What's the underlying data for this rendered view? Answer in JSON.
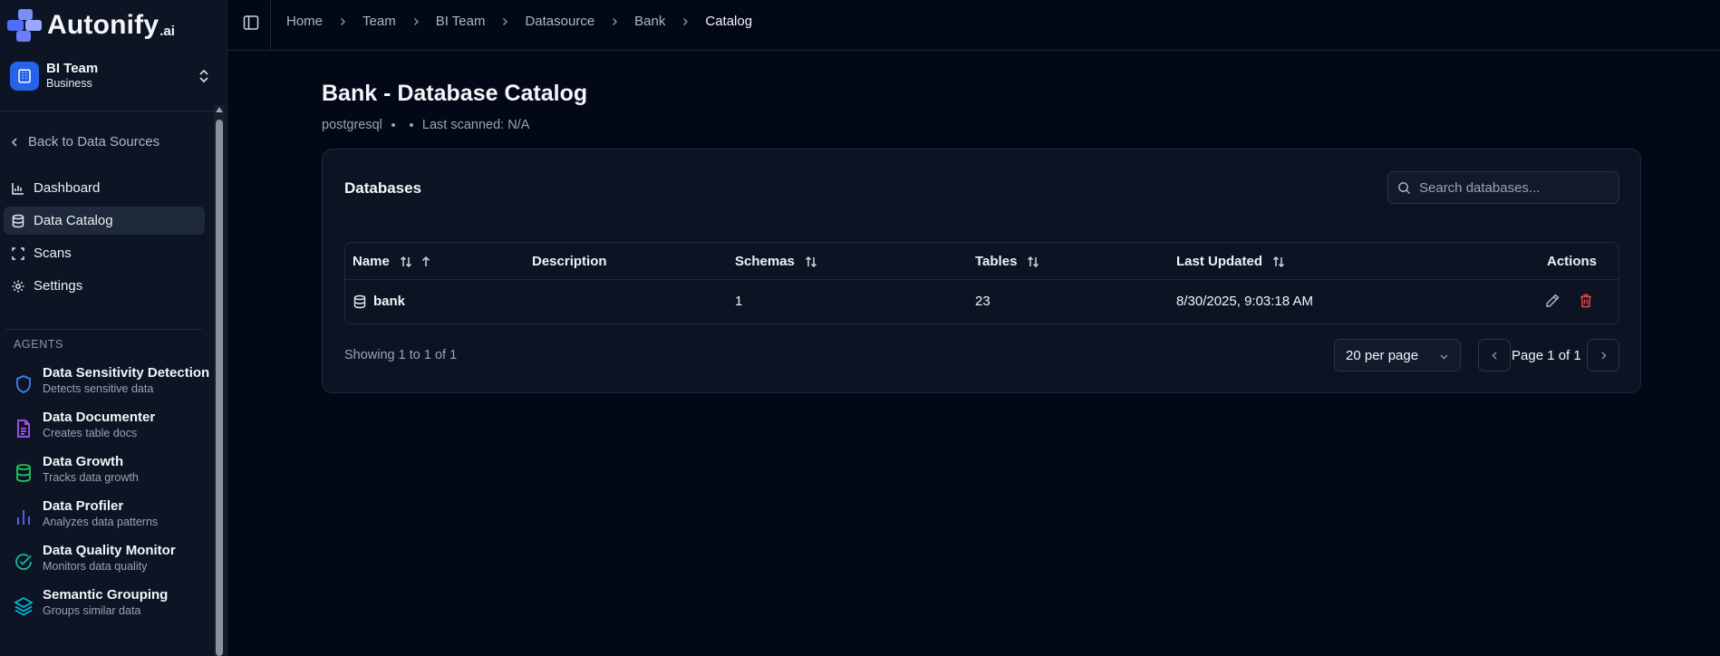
{
  "brand": {
    "name": "Autonify",
    "suffix": ".ai"
  },
  "team": {
    "name": "BI Team",
    "plan": "Business"
  },
  "sidebar": {
    "back_label": "Back to Data Sources",
    "nav": [
      {
        "label": "Dashboard",
        "icon": "bar-chart-icon",
        "active": false
      },
      {
        "label": "Data Catalog",
        "icon": "database-icon",
        "active": true
      },
      {
        "label": "Scans",
        "icon": "scan-icon",
        "active": false
      },
      {
        "label": "Settings",
        "icon": "gear-icon",
        "active": false
      }
    ],
    "agents_title": "AGENTS",
    "agents": [
      {
        "name": "Data Sensitivity Detection",
        "desc": "Detects sensitive data",
        "icon": "shield-icon",
        "color": "#3b82f6"
      },
      {
        "name": "Data Documenter",
        "desc": "Creates table docs",
        "icon": "document-icon",
        "color": "#a855f7"
      },
      {
        "name": "Data Growth",
        "desc": "Tracks data growth",
        "icon": "database-icon",
        "color": "#22c55e"
      },
      {
        "name": "Data Profiler",
        "desc": "Analyzes data patterns",
        "icon": "bar-chart-icon",
        "color": "#6366f1"
      },
      {
        "name": "Data Quality Monitor",
        "desc": "Monitors data quality",
        "icon": "check-circle-icon",
        "color": "#14b8a6"
      },
      {
        "name": "Semantic Grouping",
        "desc": "Groups similar data",
        "icon": "layers-icon",
        "color": "#06b6d4"
      }
    ]
  },
  "breadcrumb": [
    "Home",
    "Team",
    "BI Team",
    "Datasource",
    "Bank",
    "Catalog"
  ],
  "page": {
    "title": "Bank - Database Catalog",
    "db_type": "postgresql",
    "last_scanned": "Last scanned: N/A"
  },
  "card": {
    "title": "Databases",
    "search_placeholder": "Search databases..."
  },
  "table": {
    "columns": [
      "Name",
      "Description",
      "Schemas",
      "Tables",
      "Last Updated",
      "Actions"
    ],
    "rows": [
      {
        "name": "bank",
        "description": "",
        "schemas": "1",
        "tables": "23",
        "last_updated": "8/30/2025, 9:03:18 AM"
      }
    ]
  },
  "pagination": {
    "showing": "Showing 1 to 1 of 1",
    "per_page": "20 per page",
    "page_label": "Page 1 of 1"
  },
  "colors": {
    "accent": "#2563eb",
    "danger": "#ef4444"
  }
}
